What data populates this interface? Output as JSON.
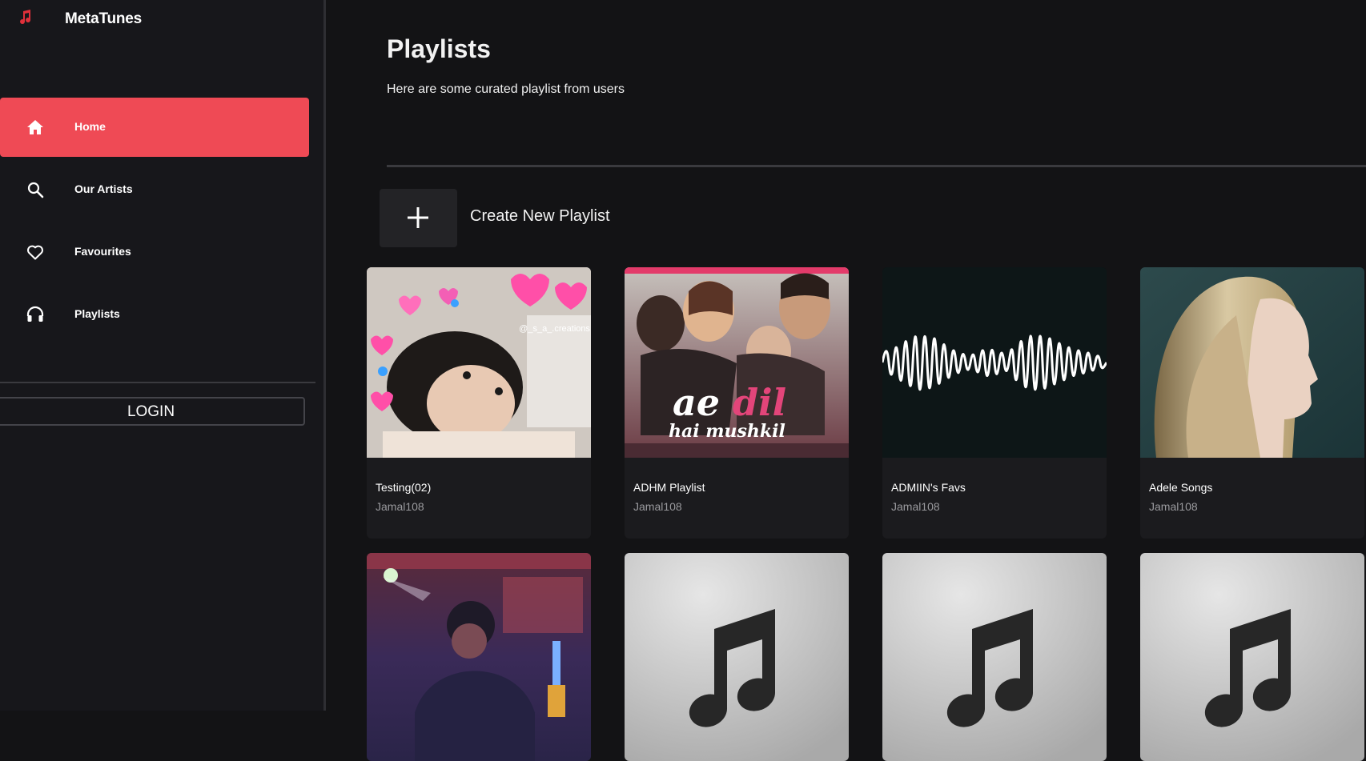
{
  "app": {
    "name": "MetaTunes",
    "brand_color": "#e0303a",
    "accent": "#ef4a55"
  },
  "sidebar": {
    "items": [
      {
        "label": "Home",
        "icon": "home-icon",
        "active": true
      },
      {
        "label": "Our Artists",
        "icon": "search-icon",
        "active": false
      },
      {
        "label": "Favourites",
        "icon": "heart-icon",
        "active": false
      },
      {
        "label": "Playlists",
        "icon": "headphones-icon",
        "active": false
      }
    ],
    "login_label": "LOGIN"
  },
  "main": {
    "title": "Playlists",
    "subtitle": "Here are some curated playlist from users",
    "create_label": "Create New Playlist",
    "playlists": [
      {
        "title": "Testing(02)",
        "owner": "Jamal108",
        "cover": "baby-photo-with-hearts",
        "watermark": "@_s_a_.creations"
      },
      {
        "title": "ADHM Playlist",
        "owner": "Jamal108",
        "cover": "movie-poster"
      },
      {
        "title": "ADMIIN's Favs",
        "owner": "Jamal108",
        "cover": "sound-wave"
      },
      {
        "title": "Adele Songs",
        "owner": "Jamal108",
        "cover": "portrait-profile"
      },
      {
        "cover": "dj-photo"
      },
      {
        "cover": "music-note-placeholder"
      },
      {
        "cover": "music-note-placeholder"
      },
      {
        "cover": "music-note-placeholder"
      }
    ]
  }
}
